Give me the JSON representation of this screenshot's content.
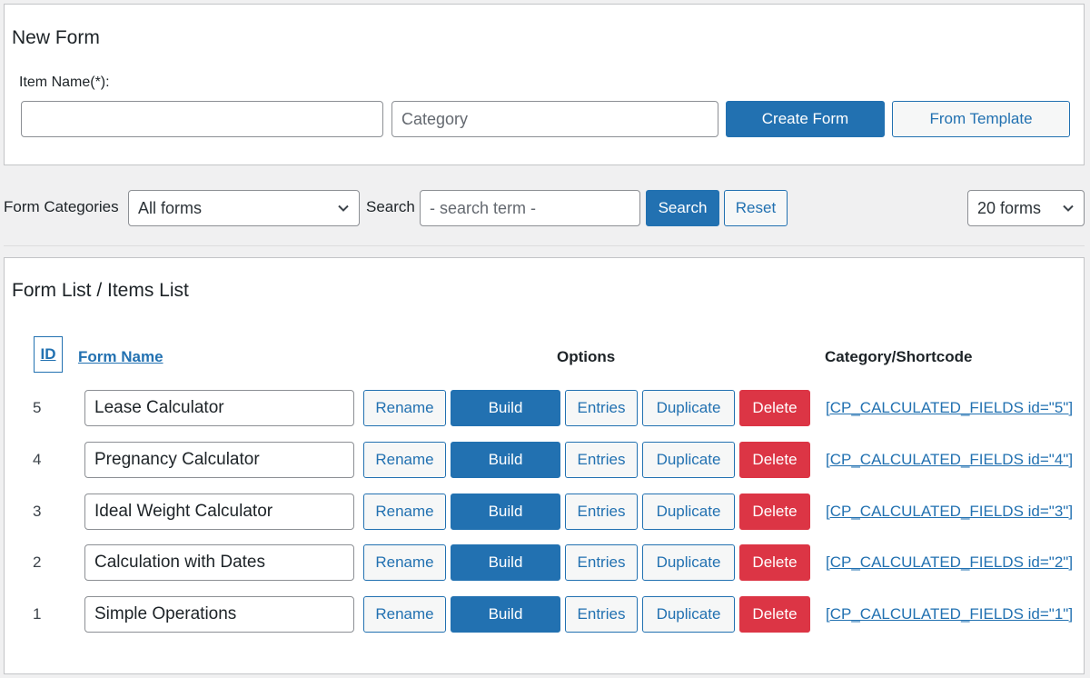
{
  "new_form": {
    "title": "New Form",
    "item_name_label": "Item Name(*):",
    "item_name_value": "",
    "category_placeholder": "Category",
    "create_button": "Create Form",
    "template_button": "From Template"
  },
  "filters": {
    "categories_label": "Form Categories",
    "categories_selected": "All forms",
    "search_label": "Search",
    "search_placeholder": "- search term -",
    "search_button": "Search",
    "reset_button": "Reset",
    "per_page_selected": "20 forms"
  },
  "list": {
    "title": "Form List / Items List",
    "columns": {
      "id": "ID",
      "name": "Form Name",
      "options": "Options",
      "category": "Category/Shortcode"
    },
    "buttons": {
      "rename": "Rename",
      "build": "Build",
      "entries": "Entries",
      "duplicate": "Duplicate",
      "delete": "Delete"
    },
    "rows": [
      {
        "id": "5",
        "name": "Lease Calculator",
        "shortcode": "[CP_CALCULATED_FIELDS id=\"5\"]"
      },
      {
        "id": "4",
        "name": "Pregnancy Calculator",
        "shortcode": "[CP_CALCULATED_FIELDS id=\"4\"]"
      },
      {
        "id": "3",
        "name": "Ideal Weight Calculator",
        "shortcode": "[CP_CALCULATED_FIELDS id=\"3\"]"
      },
      {
        "id": "2",
        "name": "Calculation with Dates",
        "shortcode": "[CP_CALCULATED_FIELDS id=\"2\"]"
      },
      {
        "id": "1",
        "name": "Simple Operations",
        "shortcode": "[CP_CALCULATED_FIELDS id=\"1\"]"
      }
    ]
  },
  "colors": {
    "primary": "#2271b1",
    "danger": "#dc3545",
    "background": "#f0f0f1"
  }
}
